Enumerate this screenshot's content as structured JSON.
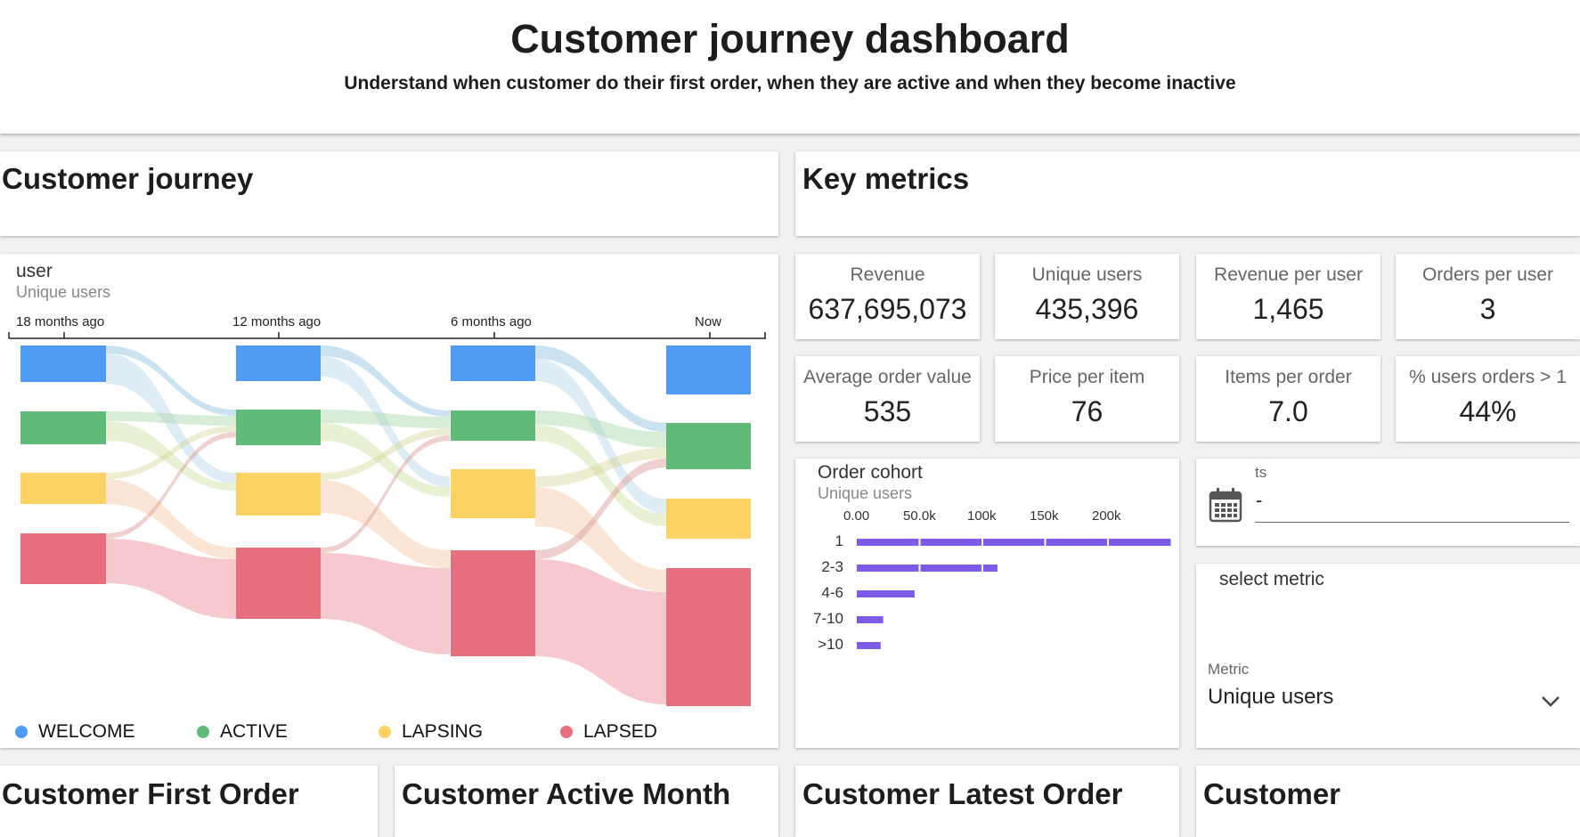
{
  "header": {
    "title": "Customer journey dashboard",
    "subtitle": "Understand when customer do their first order, when they are active and when they become inactive"
  },
  "sections": {
    "customer_journey": "Customer journey",
    "key_metrics": "Key metrics",
    "customer_first_order": "Customer First Order",
    "customer_active_month": "Customer Active Month",
    "customer_latest_order": "Customer Latest Order",
    "customer": "Customer"
  },
  "sankey": {
    "title": "user",
    "subtitle": "Unique users",
    "time_labels": [
      "18 months ago",
      "12 months ago",
      "6 months ago",
      "Now"
    ],
    "legend": [
      {
        "label": "WELCOME",
        "color": "#4f9cf4"
      },
      {
        "label": "ACTIVE",
        "color": "#61bb78"
      },
      {
        "label": "LAPSING",
        "color": "#fcd264"
      },
      {
        "label": "LAPSED",
        "color": "#e56f7c"
      }
    ]
  },
  "metrics": [
    {
      "label": "Revenue",
      "value": "637,695,073"
    },
    {
      "label": "Unique users",
      "value": "435,396"
    },
    {
      "label": "Revenue per user",
      "value": "1,465"
    },
    {
      "label": "Orders per user",
      "value": "3"
    },
    {
      "label": "Average order value",
      "value": "535"
    },
    {
      "label": "Price per item",
      "value": "76"
    },
    {
      "label": "Items per order",
      "value": "7.0"
    },
    {
      "label": "% users orders > 1",
      "value": "44%"
    }
  ],
  "cohort": {
    "title": "Order cohort",
    "subtitle": "Unique users"
  },
  "chart_data": {
    "type": "bar",
    "title": "Order cohort",
    "subtitle": "Unique users",
    "orientation": "horizontal",
    "categories": [
      "1",
      "2-3",
      "4-6",
      "7-10",
      ">10"
    ],
    "values": [
      250000,
      112000,
      46000,
      21000,
      19000
    ],
    "x_ticks": [
      "0.00",
      "50.0k",
      "100k",
      "150k",
      "200k"
    ],
    "xlim": [
      0,
      250000
    ],
    "bar_color": "#7c5ce6",
    "grid": false
  },
  "date_filter": {
    "label": "ts",
    "value": "-"
  },
  "metric_select": {
    "title": "select metric",
    "field_label": "Metric",
    "selected": "Unique users"
  }
}
